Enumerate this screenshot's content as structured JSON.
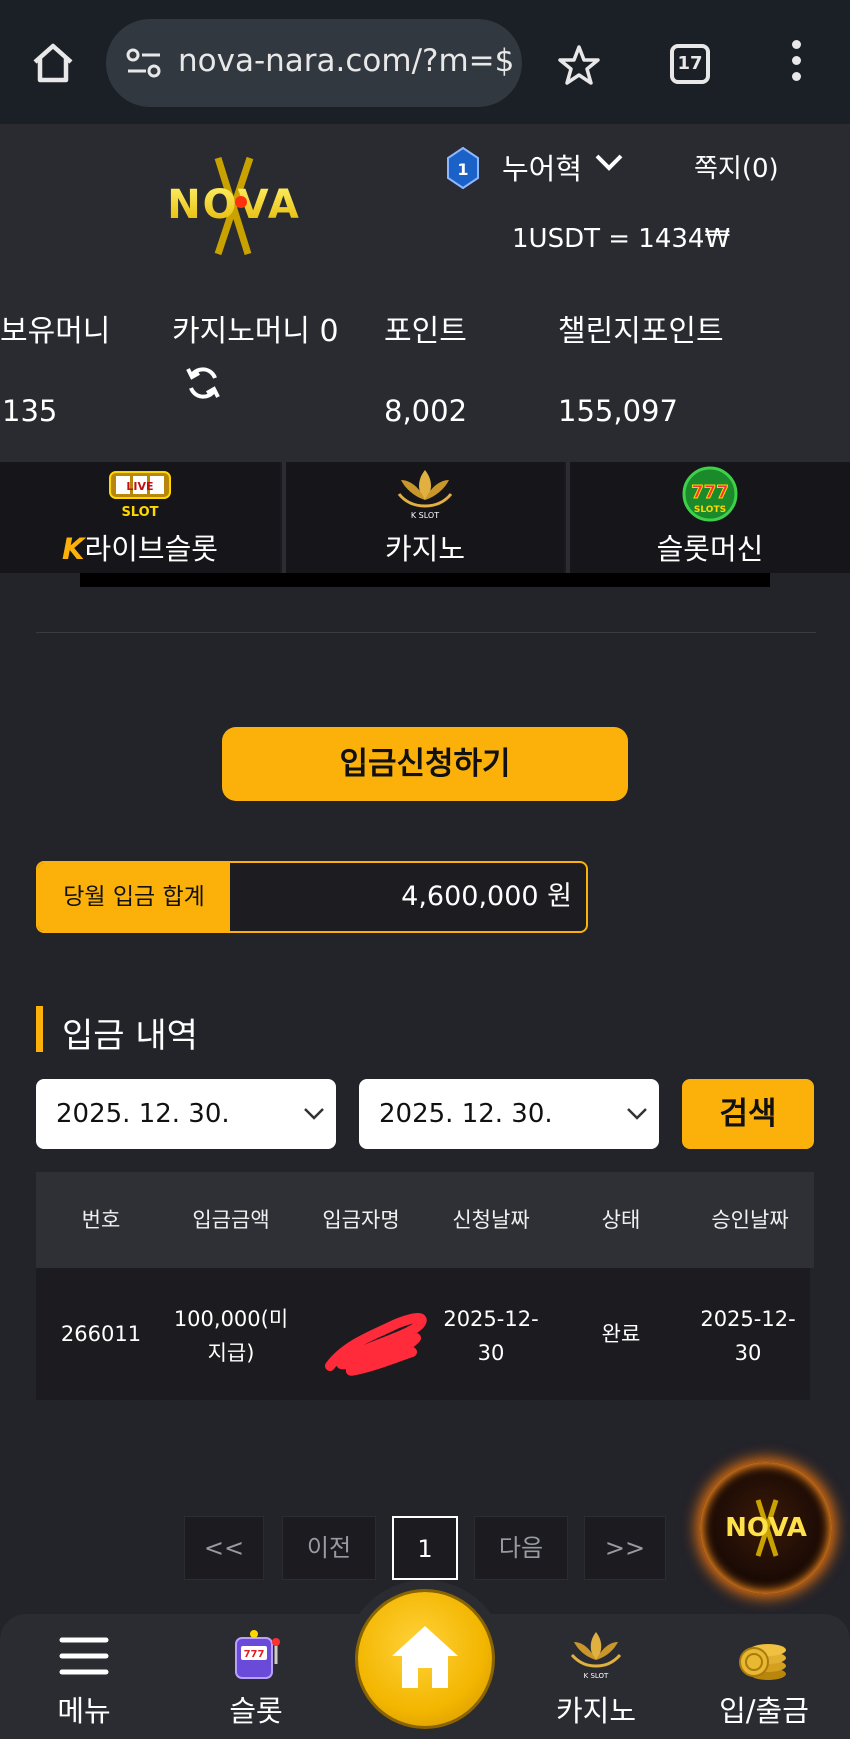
{
  "browser": {
    "url": "nova-nara.com/?m=$",
    "tab_count": "17"
  },
  "header": {
    "logo_text": "NOVA",
    "level": "1",
    "username": "누어혁",
    "memo": "쪽지(0)",
    "rate": "1USDT = 1434₩"
  },
  "balances": [
    {
      "label": "보유머니",
      "value": "135"
    },
    {
      "label": "카지노머니 0",
      "value": ""
    },
    {
      "label": "포인트",
      "value": "8,002"
    },
    {
      "label": "챌린지포인트",
      "value": "155,097"
    }
  ],
  "game_tabs": [
    {
      "label": "라이브슬롯",
      "icon": "live-slot-icon",
      "icon_text": "LIVE SLOT",
      "prefix": "K"
    },
    {
      "label": "카지노",
      "icon": "kslot-lotus-icon",
      "icon_text": "K SLOT"
    },
    {
      "label": "슬롯머신",
      "icon": "777-slots-icon",
      "icon_text": "777"
    }
  ],
  "deposit": {
    "request_button": "입금신청하기",
    "monthly_label": "당월 입금 합계",
    "monthly_value": "4,600,000 원"
  },
  "history": {
    "title": "입금 내역",
    "start_date": "2025. 12. 30.",
    "end_date": "2025. 12. 30.",
    "search_button": "검색",
    "columns": [
      "번호",
      "입금금액",
      "입금자명",
      "신청날짜",
      "상태",
      "승인날짜"
    ],
    "rows": [
      {
        "no": "266011",
        "amount": "100,000(미\n지급)",
        "name": "",
        "request_date": "2025-12-\n30",
        "status": "완료",
        "approve_date": "2025-12-\n30"
      }
    ]
  },
  "pagination": {
    "first": "<<",
    "prev": "이전",
    "current": "1",
    "next": "다음",
    "last": ">>"
  },
  "bottom_nav": [
    {
      "label": "메뉴",
      "icon": "hamburger-menu-icon"
    },
    {
      "label": "슬롯",
      "icon": "slot-machine-icon"
    },
    {
      "label": "",
      "icon": "home-icon"
    },
    {
      "label": "카지노",
      "icon": "kslot-lotus-icon"
    },
    {
      "label": "입/출금",
      "icon": "coins-icon"
    }
  ],
  "colors": {
    "accent": "#fbb10a",
    "background": "#23232a",
    "header": "#2a2b30"
  }
}
